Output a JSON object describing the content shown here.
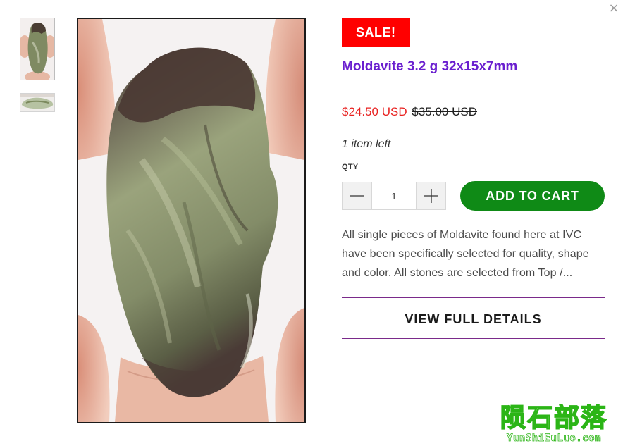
{
  "dialog": {
    "close_icon": "close-icon",
    "close_glyph": "×"
  },
  "gallery": {
    "thumbnails": [
      {
        "icon": "moldavite-front-thumbnail",
        "selected": true
      },
      {
        "icon": "moldavite-side-thumbnail",
        "selected": false
      }
    ],
    "main_image": "moldavite-stone-photo"
  },
  "product": {
    "badge": "SALE!",
    "title": "Moldavite 3.2 g 32x15x7mm",
    "price": "$24.50 USD",
    "compare_price": "$35.00 USD",
    "stock": "1 item left",
    "qty_label": "QTY",
    "qty_value": "1",
    "add_to_cart": "ADD TO CART",
    "description": "All single pieces of Moldavite found here at IVC have been specifically selected for quality, shape and color. All stones are selected from Top /...",
    "view_details": "VIEW FULL DETAILS"
  },
  "watermark": {
    "chinese": "陨石部落",
    "latin": "YunShiEuLuo.com"
  },
  "colors": {
    "title": "#6a1fcf",
    "sale_badge": "#ff0000",
    "sale_price": "#e8201f",
    "add_to_cart": "#0f8a16",
    "divider": "#7a2a8a",
    "watermark": "#2bb516"
  }
}
